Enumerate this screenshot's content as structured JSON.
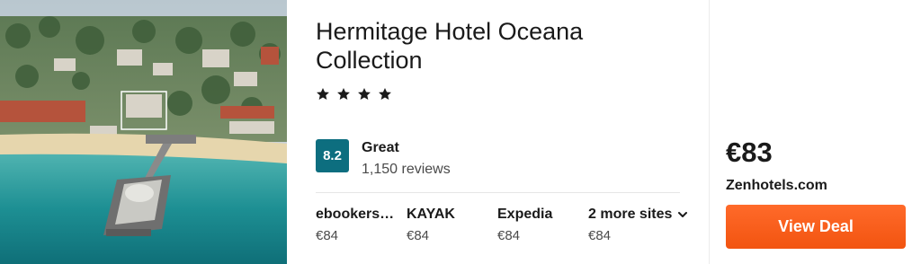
{
  "hotel": {
    "name": "Hermitage Hotel Oceana Collection",
    "star_count": 4,
    "photo_icon": "hotel-photo"
  },
  "rating": {
    "score": "8.2",
    "label": "Great",
    "reviews": "1,150 reviews",
    "badge_color": "#0d6e7f"
  },
  "sites": [
    {
      "name": "ebookers…",
      "price": "€84"
    },
    {
      "name": "KAYAK",
      "price": "€84"
    },
    {
      "name": "Expedia",
      "price": "€84"
    },
    {
      "name": "2 more sites",
      "price": "€84",
      "icon": "chevron-down-icon"
    }
  ],
  "deal": {
    "price": "€83",
    "provider": "Zenhotels.com",
    "button_label": "View Deal",
    "button_color": "#f25410"
  }
}
